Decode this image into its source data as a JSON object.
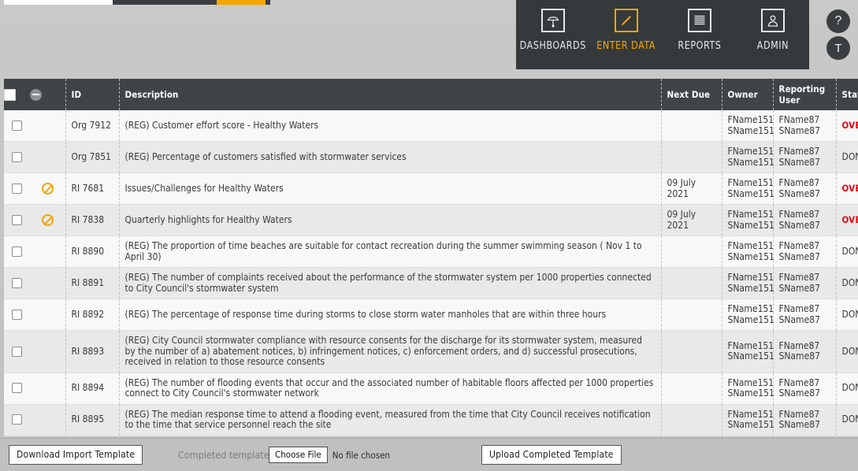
{
  "top_strip": {
    "colors": {
      "white": "#ffffff",
      "dark": "#3b3f42",
      "orange": "#f5a700"
    }
  },
  "nav": {
    "items": [
      {
        "label": "DASHBOARDS",
        "icon": "gauge-icon",
        "active": false
      },
      {
        "label": "ENTER DATA",
        "icon": "pencil-icon",
        "active": true
      },
      {
        "label": "REPORTS",
        "icon": "document-lines-icon",
        "active": false
      },
      {
        "label": "ADMIN",
        "icon": "person-icon",
        "active": false
      }
    ],
    "help_button": "?",
    "user_button": "T",
    "accent_color": "#f5a700"
  },
  "table": {
    "columns": [
      {
        "key": "check",
        "label": ""
      },
      {
        "key": "icon",
        "label": ""
      },
      {
        "key": "id",
        "label": "ID"
      },
      {
        "key": "desc",
        "label": "Description"
      },
      {
        "key": "due",
        "label": "Next Due"
      },
      {
        "key": "owner",
        "label": "Owner"
      },
      {
        "key": "rep",
        "label": "Reporting User"
      },
      {
        "key": "status",
        "label": "Status"
      }
    ],
    "header_icons": {
      "select_all": "checkbox-icon",
      "deselect": "minus-circle-icon"
    },
    "rows": [
      {
        "icon": "checkbox",
        "id": "Org 7912",
        "desc": "(REG) Customer effort score - Healthy Waters",
        "due": "",
        "owner1": "FName151",
        "owner2": "SName151",
        "rep1": "FName87",
        "rep2": "SName87",
        "status": "OVERDUE"
      },
      {
        "icon": "checkbox",
        "id": "Org 7851",
        "desc": "(REG) Percentage of customers satisfied with stormwater services",
        "due": "",
        "owner1": "FName151",
        "owner2": "SName151",
        "rep1": "FName87",
        "rep2": "SName87",
        "status": "DONE"
      },
      {
        "icon": "ban",
        "id": "RI 7681",
        "desc": "Issues/Challenges for Healthy Waters",
        "due": "09 July 2021",
        "owner1": "FName151",
        "owner2": "SName151",
        "rep1": "FName87",
        "rep2": "SName87",
        "status": "OVERDUE"
      },
      {
        "icon": "ban",
        "id": "RI 7838",
        "desc": "Quarterly highlights for Healthy Waters",
        "due": "09 July 2021",
        "owner1": "FName151",
        "owner2": "SName151",
        "rep1": "FName87",
        "rep2": "SName87",
        "status": "OVERDUE"
      },
      {
        "icon": "checkbox",
        "id": "RI 8890",
        "desc": "(REG) The proportion of time beaches are suitable for contact recreation during the summer swimming season ( Nov 1 to April 30)",
        "due": "",
        "owner1": "FName151",
        "owner2": "SName151",
        "rep1": "FName87",
        "rep2": "SName87",
        "status": "DONE"
      },
      {
        "icon": "checkbox",
        "id": "RI 8891",
        "desc": "(REG) The number of complaints received about the performance of the stormwater system per 1000 properties connected to City Council's stormwater system",
        "due": "",
        "owner1": "FName151",
        "owner2": "SName151",
        "rep1": "FName87",
        "rep2": "SName87",
        "status": "DONE"
      },
      {
        "icon": "checkbox",
        "id": "RI 8892",
        "desc": "(REG) The percentage of response time during storms to close storm water manholes that are within three hours",
        "due": "",
        "owner1": "FName151",
        "owner2": "SName151",
        "rep1": "FName87",
        "rep2": "SName87",
        "status": "DONE"
      },
      {
        "icon": "checkbox",
        "id": "RI 8893",
        "desc": "(REG) City Council stormwater compliance with resource consents for the discharge for its stormwater system, measured by the number of a) abatement notices, b) infringement notices, c) enforcement orders, and d) successful prosecutions, received in relation to those resource consents",
        "due": "",
        "owner1": "FName151",
        "owner2": "SName151",
        "rep1": "FName87",
        "rep2": "SName87",
        "status": "DONE"
      },
      {
        "icon": "checkbox",
        "id": "RI 8894",
        "desc": "(REG) The number of flooding events that occur and the associated number of habitable floors affected per 1000 properties connect to City Council's stormwater network",
        "due": "",
        "owner1": "FName151",
        "owner2": "SName151",
        "rep1": "FName87",
        "rep2": "SName87",
        "status": "DONE"
      },
      {
        "icon": "checkbox",
        "id": "RI 8895",
        "desc": "(REG) The median response time to attend a flooding event, measured from the time that City Council receives notification to the time that service personnel reach the site",
        "due": "",
        "owner1": "FName151",
        "owner2": "SName151",
        "rep1": "FName87",
        "rep2": "SName87",
        "status": "DONE"
      }
    ],
    "status_colors": {
      "overdue": "#e30613",
      "done": "#3a3a3a"
    }
  },
  "bottom_bar": {
    "download_label": "Download Import Template",
    "completed_template_label": "Completed template:",
    "choose_file_label": "Choose File",
    "no_file_text": "No file chosen",
    "upload_label": "Upload Completed Template"
  }
}
